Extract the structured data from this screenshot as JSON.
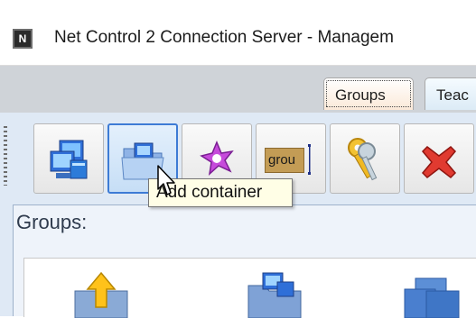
{
  "window": {
    "icon_glyph": "N",
    "icon_name": "app-icon",
    "title": "Net Control 2 Connection Server - Managem"
  },
  "tabs": [
    {
      "label": "Groups",
      "selected": true
    },
    {
      "label": "Teac",
      "selected": false
    }
  ],
  "toolbar": {
    "buttons": [
      {
        "name": "computers-icon",
        "tooltip": ""
      },
      {
        "name": "add-container-icon",
        "tooltip": "Add container",
        "hovered": true
      },
      {
        "name": "star-icon",
        "tooltip": ""
      },
      {
        "name": "rename-icon",
        "tooltip": "",
        "text": "grou"
      },
      {
        "name": "keys-icon",
        "tooltip": ""
      },
      {
        "name": "delete-icon",
        "tooltip": ""
      }
    ]
  },
  "tooltip": {
    "text": "Add container"
  },
  "groups": {
    "label": "Groups:",
    "items": [
      {
        "name": "folder-up-icon"
      },
      {
        "name": "folder-computers-icon"
      },
      {
        "name": "group-folder-icon"
      }
    ]
  },
  "colors": {
    "panel_bg": "#dfe9f5",
    "tab_strip": "#cfd3d8",
    "selected_button_border": "#3d7bd5",
    "tooltip_bg": "#fffee6"
  }
}
